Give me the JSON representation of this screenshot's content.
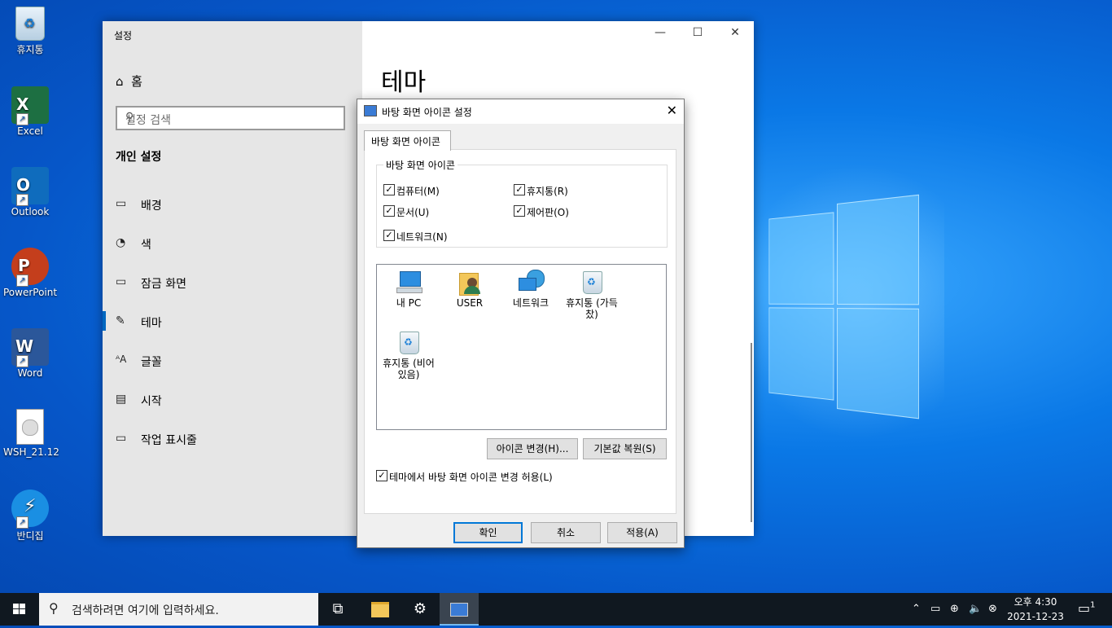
{
  "desktop": {
    "icons": [
      {
        "label": "휴지통",
        "icon": "recycle-bin-icon"
      },
      {
        "label": "Excel",
        "icon": "excel-icon",
        "color": "#1d6f42"
      },
      {
        "label": "Outlook",
        "icon": "outlook-icon",
        "color": "#0f6cbd"
      },
      {
        "label": "PowerPoint",
        "icon": "powerpoint-icon",
        "color": "#c43e1c"
      },
      {
        "label": "Word",
        "icon": "word-icon",
        "color": "#2b579a"
      },
      {
        "label": "WSH_21.12",
        "icon": "disc-image-icon"
      },
      {
        "label": "반디집",
        "icon": "bandizip-icon",
        "color": "#1a8fe3"
      }
    ]
  },
  "settings": {
    "title": "설정",
    "home": "홈",
    "search_placeholder": "설정 검색",
    "section": "개인 설정",
    "nav": [
      {
        "label": "배경",
        "icon": "image-icon"
      },
      {
        "label": "색",
        "icon": "palette-icon"
      },
      {
        "label": "잠금 화면",
        "icon": "lock-screen-icon"
      },
      {
        "label": "테마",
        "icon": "theme-brush-icon",
        "active": true
      },
      {
        "label": "글꼴",
        "icon": "font-icon"
      },
      {
        "label": "시작",
        "icon": "start-icon"
      },
      {
        "label": "작업 표시줄",
        "icon": "taskbar-icon"
      }
    ],
    "page_title": "테마",
    "accent": "#0067c0"
  },
  "dialog": {
    "title": "바탕 화면 아이콘 설정",
    "tab": "바탕 화면 아이콘",
    "group_label": "바탕 화면 아이콘",
    "checkboxes": {
      "computer": "컴퓨터(M)",
      "recycle": "휴지통(R)",
      "documents": "문서(U)",
      "control_panel": "제어판(O)",
      "network": "네트워크(N)"
    },
    "icons": [
      {
        "label": "내 PC"
      },
      {
        "label": "USER"
      },
      {
        "label": "네트워크"
      },
      {
        "label": "휴지통 (가득 찼)"
      },
      {
        "label": "휴지통 (비어 있음)"
      }
    ],
    "change_icon": "아이콘 변경(H)...",
    "restore_default": "기본값 복원(S)",
    "allow_themes": "테마에서 바탕 화면 아이콘 변경 허용(L)",
    "ok": "확인",
    "cancel": "취소",
    "apply": "적용(A)"
  },
  "taskbar": {
    "search_placeholder": "검색하려면 여기에 입력하세요.",
    "time": "오후 4:30",
    "date": "2021-12-23",
    "notification_count": "1"
  }
}
